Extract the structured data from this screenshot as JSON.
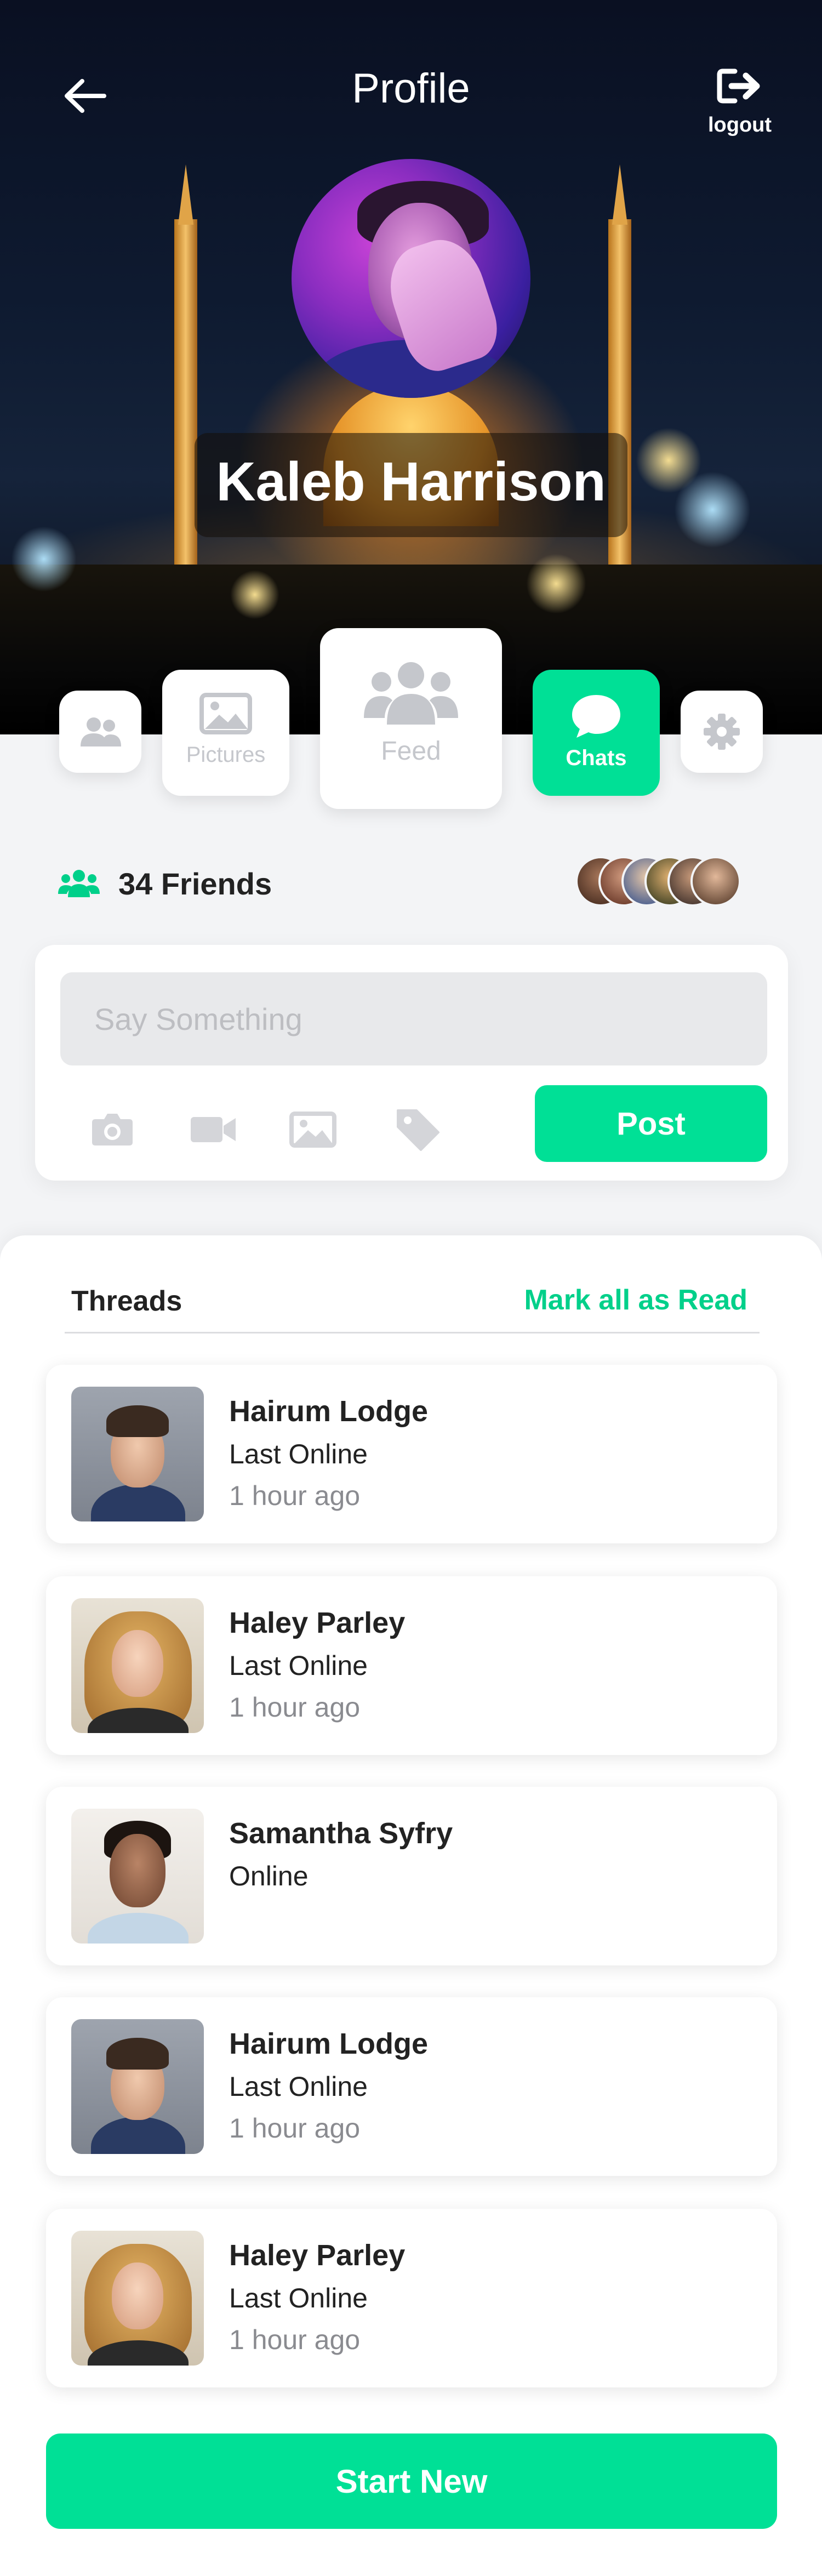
{
  "header": {
    "title": "Profile",
    "logout_label": "logout",
    "profile_name": "Kaleb Harrison"
  },
  "tabs": [
    {
      "label": "",
      "icon": "users-icon"
    },
    {
      "label": "Pictures",
      "icon": "image-icon"
    },
    {
      "label": "Feed",
      "icon": "users-icon"
    },
    {
      "label": "Chats",
      "icon": "chat-bubble-icon",
      "active": true
    },
    {
      "label": "",
      "icon": "gear-icon"
    }
  ],
  "friends": {
    "count_label": "34 Friends"
  },
  "composer": {
    "placeholder": "Say Something",
    "post_label": "Post",
    "icons": [
      "camera-icon",
      "video-icon",
      "image-icon",
      "tag-icon"
    ]
  },
  "threads": {
    "title": "Threads",
    "mark_all_label": "Mark all as Read",
    "items": [
      {
        "name": "Hairum Lodge",
        "status": "Last Online",
        "time": "1 hour ago"
      },
      {
        "name": "Haley Parley",
        "status": "Last Online",
        "time": "1 hour ago"
      },
      {
        "name": "Samantha Syfry",
        "status": "Online",
        "time": ""
      },
      {
        "name": "Hairum Lodge",
        "status": "Last Online",
        "time": "1 hour ago"
      },
      {
        "name": "Haley Parley",
        "status": "Last Online",
        "time": "1 hour ago"
      }
    ]
  },
  "start_new_label": "Start New",
  "colors": {
    "accent": "#00E096",
    "background": "#F3F4F6",
    "card": "#FFFFFF"
  }
}
